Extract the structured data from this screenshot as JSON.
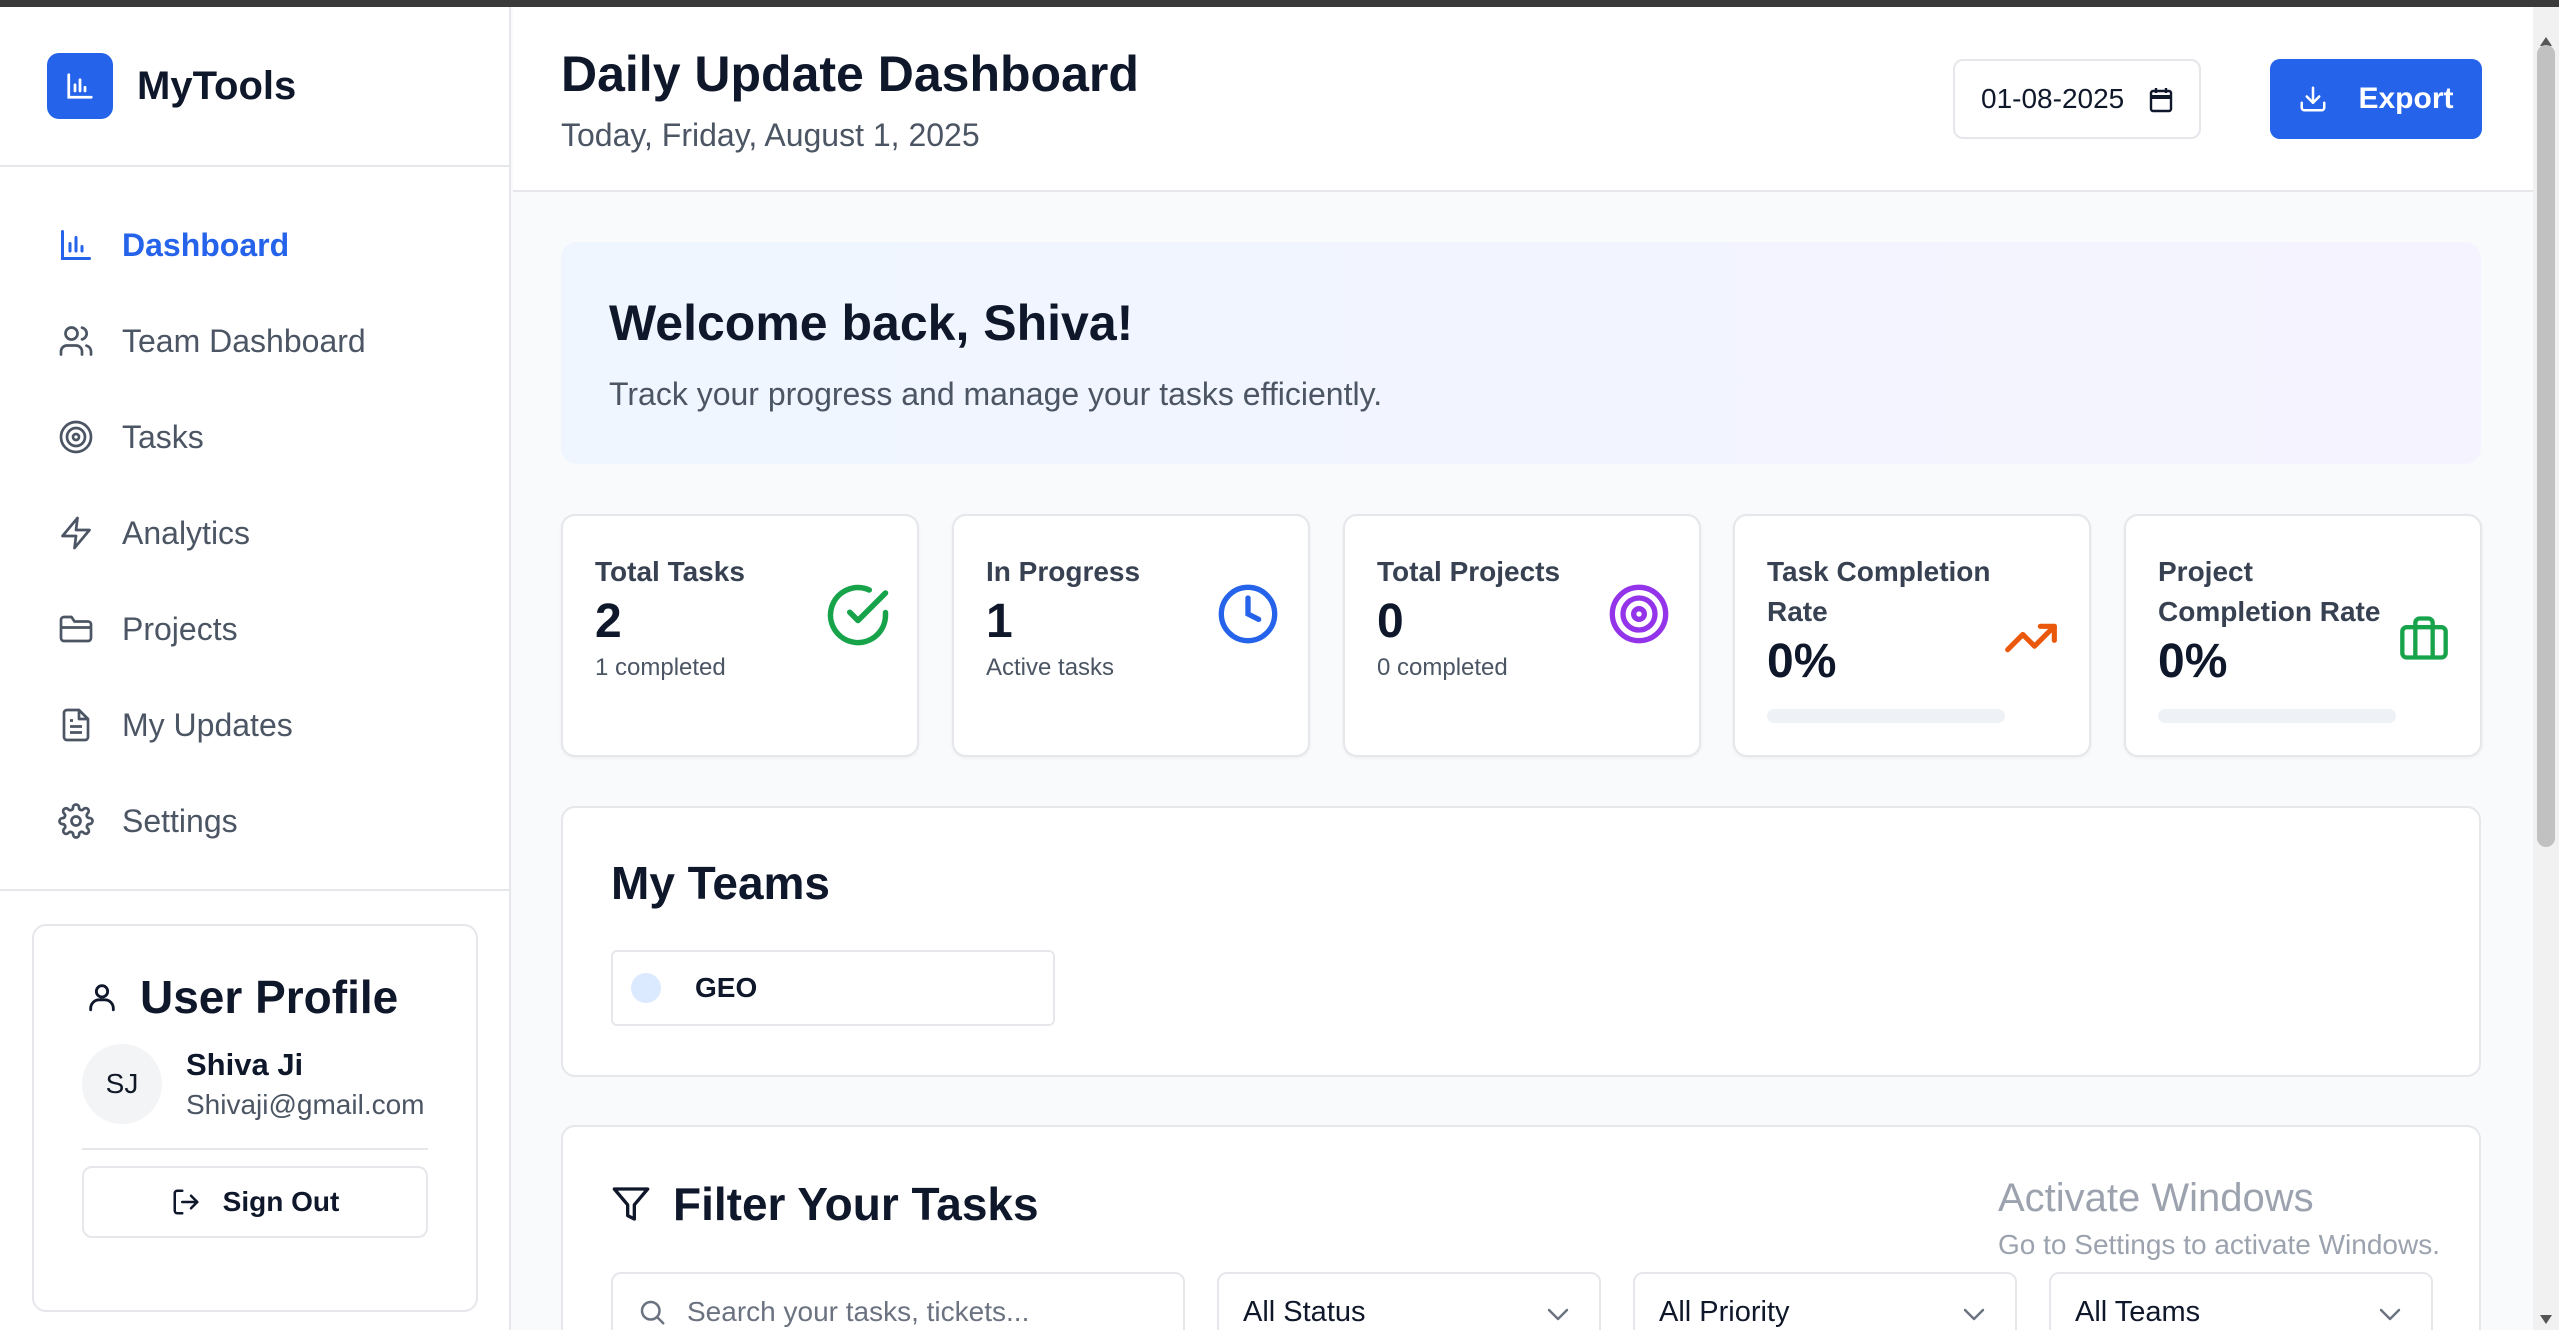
{
  "brand": {
    "name": "MyTools"
  },
  "nav": {
    "items": [
      {
        "label": "Dashboard",
        "icon": "bar-chart-icon",
        "active": true
      },
      {
        "label": "Team Dashboard",
        "icon": "users-icon"
      },
      {
        "label": "Tasks",
        "icon": "target-icon"
      },
      {
        "label": "Analytics",
        "icon": "zap-icon"
      },
      {
        "label": "Projects",
        "icon": "folder-icon"
      },
      {
        "label": "My Updates",
        "icon": "file-text-icon"
      },
      {
        "label": "Settings",
        "icon": "gear-icon"
      }
    ]
  },
  "profile": {
    "title": "User Profile",
    "initials": "SJ",
    "name": "Shiva Ji",
    "email": "Shivaji@gmail.com",
    "signout_label": "Sign Out"
  },
  "header": {
    "title": "Daily Update Dashboard",
    "date_text": "Today, Friday, August 1, 2025",
    "date_value": "01-08-2025",
    "export_label": "Export"
  },
  "welcome": {
    "title": "Welcome back, Shiva!",
    "subtitle": "Track your progress and manage your tasks efficiently."
  },
  "stats": [
    {
      "label": "Total Tasks",
      "value": "2",
      "sub": "1 completed",
      "icon": "check-circle-icon",
      "color": "#16a34a"
    },
    {
      "label": "In Progress",
      "value": "1",
      "sub": "Active tasks",
      "icon": "clock-icon",
      "color": "#2563eb"
    },
    {
      "label": "Total Projects",
      "value": "0",
      "sub": "0 completed",
      "icon": "target-icon",
      "color": "#9333ea"
    },
    {
      "label_line1": "Task Completion",
      "label_line2": "Rate",
      "value": "0%",
      "progress": 0,
      "icon": "trending-up-icon",
      "color": "#ea580c"
    },
    {
      "label_line1": "Project",
      "label_line2": "Completion Rate",
      "value": "0%",
      "progress": 0,
      "icon": "briefcase-icon",
      "color": "#16a34a"
    }
  ],
  "teams": {
    "title": "My Teams",
    "items": [
      {
        "name": "GEO"
      }
    ]
  },
  "filter": {
    "title": "Filter Your Tasks",
    "search_placeholder": "Search your tasks, tickets...",
    "status": "All Status",
    "priority": "All Priority",
    "teams": "All Teams"
  },
  "watermark": {
    "title": "Activate Windows",
    "subtitle": "Go to Settings to activate Windows."
  },
  "colors": {
    "accent": "#2563eb",
    "nav_inactive": "#4b5563"
  }
}
